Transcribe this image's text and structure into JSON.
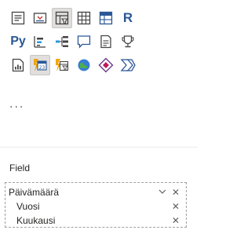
{
  "visuals": [
    {
      "id": "multi-row-card-icon",
      "color": "#444444"
    },
    {
      "id": "slicer-icon",
      "color": "#444444"
    },
    {
      "id": "table-icon",
      "color": "#444444",
      "selected": true
    },
    {
      "id": "matrix-icon",
      "color": "#444444"
    },
    {
      "id": "matrix-icon-2",
      "color": "#2b5797"
    },
    {
      "id": "r-visual-icon",
      "color": "#2b5797",
      "label": "R"
    },
    {
      "id": "python-visual-icon",
      "color": "#2b5797",
      "label": "Py"
    },
    {
      "id": "key-influencers-icon",
      "color": "#444444"
    },
    {
      "id": "decomposition-tree-icon",
      "color": "#444444"
    },
    {
      "id": "qa-icon",
      "color": "#2b5797"
    },
    {
      "id": "smart-narrative-icon",
      "color": "#444444"
    },
    {
      "id": "trophy-icon",
      "color": "#444444"
    },
    {
      "id": "paginated-report-icon",
      "color": "#444444"
    },
    {
      "id": "power-apps-calendar-icon",
      "color": "#f2a60c",
      "selected": true
    },
    {
      "id": "power-automate-icon",
      "color": "#444444"
    },
    {
      "id": "arcgis-map-icon",
      "color": "#3a7bd5"
    },
    {
      "id": "power-apps-diamond-icon",
      "color": "#6a3b8c"
    },
    {
      "id": "power-automate-arrows-icon",
      "color": "#2b5797"
    }
  ],
  "more_label": "...",
  "field_section": {
    "label": "Field",
    "items": [
      {
        "name": "Päivämäärä",
        "has_dropdown": true
      },
      {
        "name": "Vuosi",
        "has_dropdown": false
      },
      {
        "name": "Kuukausi",
        "has_dropdown": false
      }
    ]
  },
  "glyphs": {
    "close": "✕",
    "chevron": "⌄"
  }
}
